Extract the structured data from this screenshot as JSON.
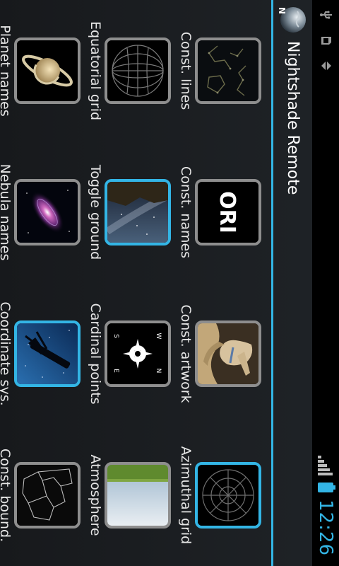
{
  "status_bar": {
    "time": "12:26"
  },
  "app": {
    "title": "Nightshade Remote"
  },
  "grid": [
    {
      "label": "Const. lines",
      "active": false,
      "icon": "constellation-lines-icon"
    },
    {
      "label": "Const. names",
      "active": false,
      "icon": "constellation-names-icon",
      "text": "ORI"
    },
    {
      "label": "Const. artwork",
      "active": false,
      "icon": "constellation-artwork-icon"
    },
    {
      "label": "Azimuthal grid",
      "active": true,
      "icon": "azimuthal-grid-icon"
    },
    {
      "label": "Equatorial grid",
      "active": false,
      "icon": "equatorial-grid-icon"
    },
    {
      "label": "Toggle ground",
      "active": true,
      "icon": "ground-icon"
    },
    {
      "label": "Cardinal points",
      "active": false,
      "icon": "compass-icon",
      "points": [
        "N",
        "E",
        "S",
        "W"
      ]
    },
    {
      "label": "Atmosphere",
      "active": false,
      "icon": "atmosphere-icon"
    },
    {
      "label": "Planet names",
      "active": false,
      "icon": "planet-icon"
    },
    {
      "label": "Nebula names",
      "active": false,
      "icon": "nebula-icon"
    },
    {
      "label": "Coordinate sys.",
      "active": true,
      "icon": "telescope-icon"
    },
    {
      "label": "Const. bound.",
      "active": false,
      "icon": "constellation-boundaries-icon"
    }
  ],
  "colors": {
    "accent": "#33b5e5",
    "tile_border": "#8e8e8e"
  }
}
